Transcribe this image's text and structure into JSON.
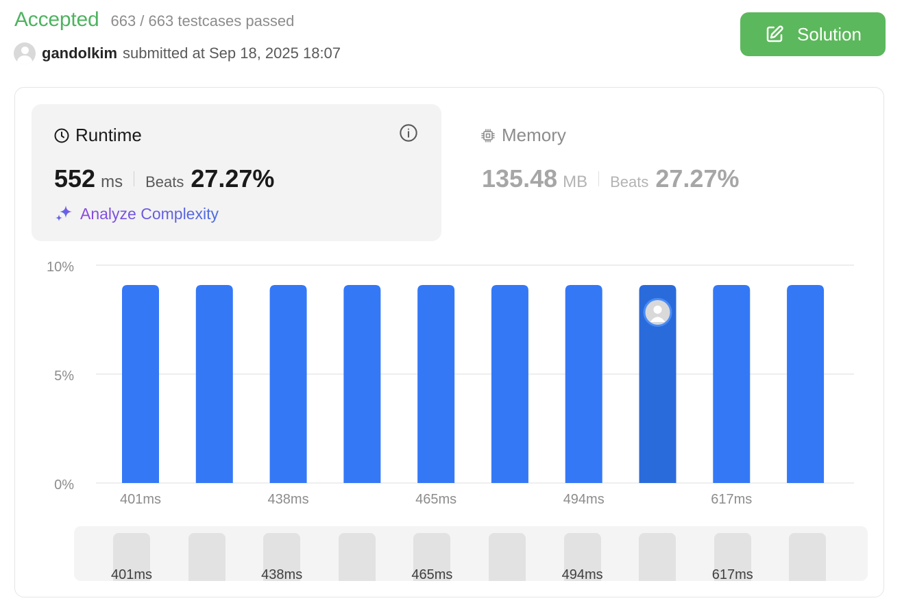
{
  "header": {
    "status": "Accepted",
    "testcases": "663 / 663 testcases passed",
    "username": "gandolkim",
    "submitted_text": "submitted at Sep 18, 2025 18:07",
    "solution_label": "Solution"
  },
  "runtime": {
    "label": "Runtime",
    "value": "552",
    "unit": "ms",
    "beats_label": "Beats",
    "beats_value": "27.27%",
    "analyze_label": "Analyze Complexity"
  },
  "memory": {
    "label": "Memory",
    "value": "135.48",
    "unit": "MB",
    "beats_label": "Beats",
    "beats_value": "27.27%"
  },
  "colors": {
    "accepted": "#4db35e",
    "solution_button": "#5cb85c",
    "bar": "#3478f6",
    "bar_selected": "#2a6bdc"
  },
  "icons": {
    "solution": "edit-icon",
    "runtime": "clock-icon",
    "info": "info-icon",
    "memory": "chip-icon",
    "analyze": "sparkle-icon"
  },
  "chart_data": {
    "type": "bar",
    "y_ticks": [
      "10%",
      "5%",
      "0%"
    ],
    "ylim": [
      0,
      10
    ],
    "values": [
      9.09,
      9.09,
      9.09,
      9.09,
      9.09,
      9.09,
      9.09,
      9.09,
      9.09,
      9.09
    ],
    "selected_index": 7,
    "x_tick_labels": [
      "401ms",
      "438ms",
      "465ms",
      "494ms",
      "617ms"
    ],
    "grid": true
  },
  "mini_labels": [
    "401ms",
    "438ms",
    "465ms",
    "494ms",
    "617ms"
  ]
}
